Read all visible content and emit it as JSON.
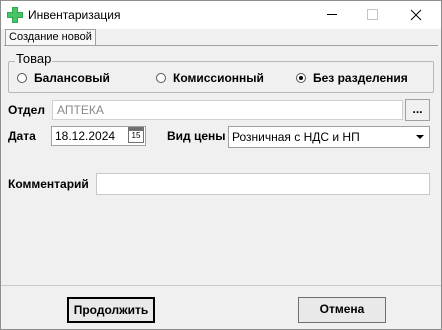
{
  "window": {
    "title": "Инвентаризация",
    "icon": "green-cross-icon"
  },
  "tabs": [
    {
      "label": "Создание новой",
      "active": true
    }
  ],
  "goods_group": {
    "legend": "Товар",
    "options": [
      {
        "label": "Балансовый",
        "checked": false
      },
      {
        "label": "Комиссионный",
        "checked": false
      },
      {
        "label": "Без разделения",
        "checked": true
      }
    ]
  },
  "form": {
    "department_label": "Отдел",
    "department_value": "АПТЕКА",
    "browse_label": "...",
    "date_label": "Дата",
    "date_value": "18.12.2024",
    "calendar_label": "15",
    "price_type_label": "Вид цены",
    "price_type_value": "Розничная с НДС и НП",
    "comment_label": "Комментарий",
    "comment_value": ""
  },
  "buttons": {
    "continue": "Продолжить",
    "cancel": "Отмена"
  }
}
